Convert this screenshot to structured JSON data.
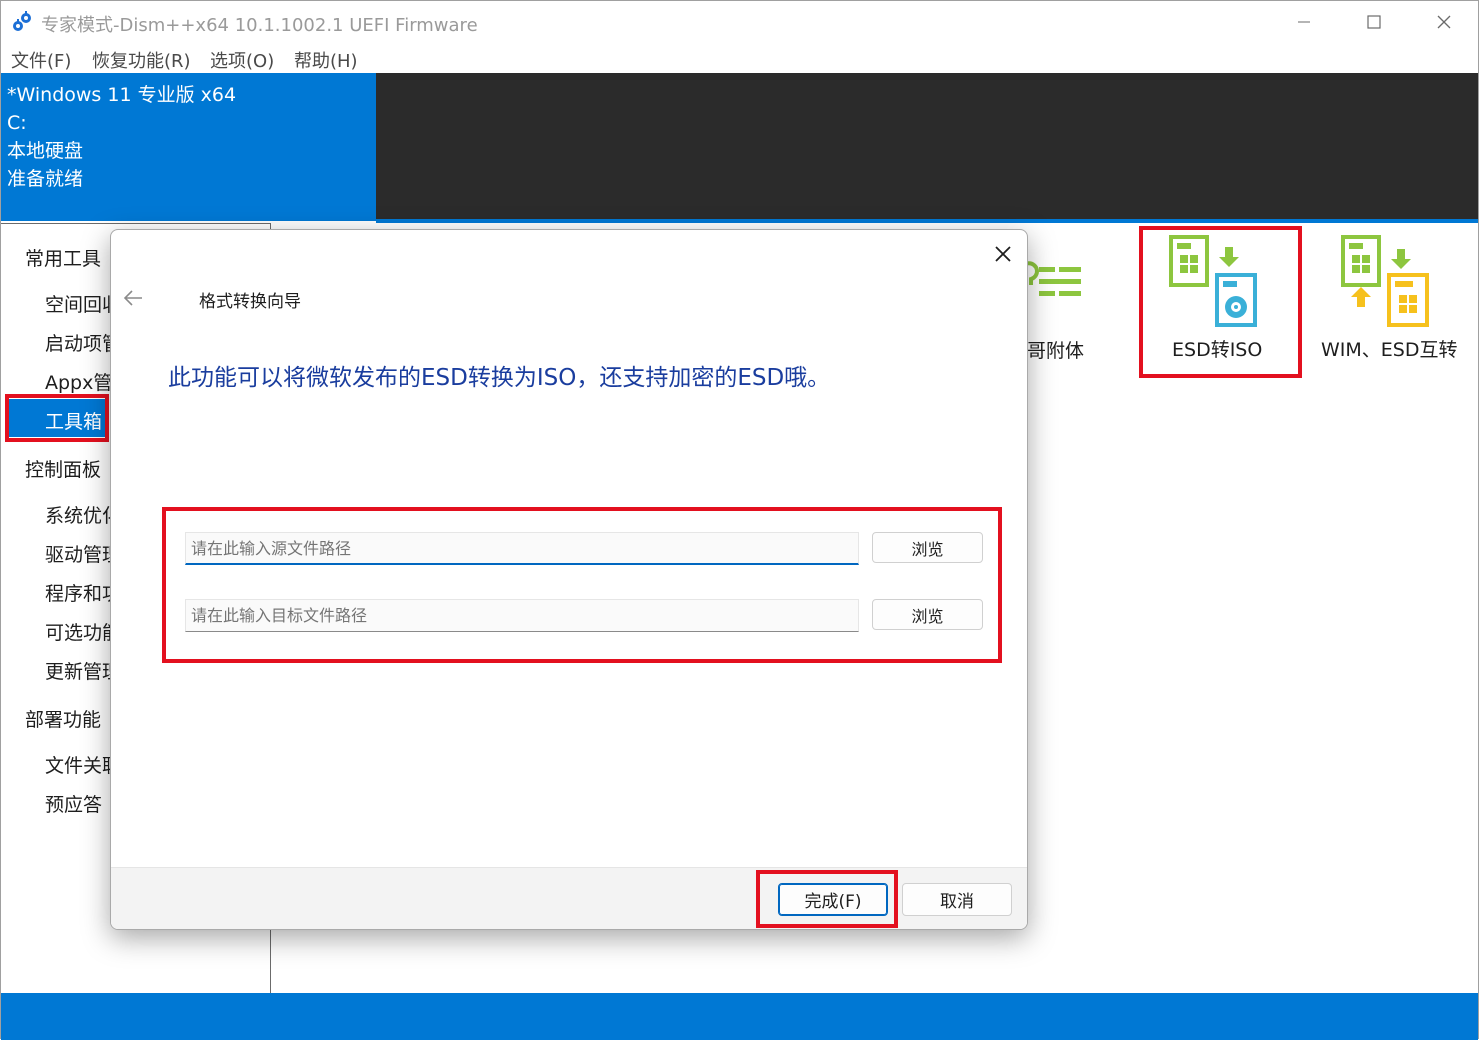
{
  "window": {
    "title": "专家模式-Dism++x64 10.1.1002.1 UEFI Firmware"
  },
  "menu": [
    "文件(F)",
    "恢复功能(R)",
    "选项(O)",
    "帮助(H)"
  ],
  "image_info": {
    "name": "*Windows 11 专业版 x64",
    "drive": "C:",
    "disk": "本地硬盘",
    "status": "准备就绪"
  },
  "sidebar": {
    "groups": [
      {
        "label": "常用工具",
        "items": [
          "空间回收",
          "启动项管",
          "Appx管",
          "工具箱"
        ]
      },
      {
        "label": "控制面板",
        "items": [
          "系统优化",
          "驱动管理",
          "程序和功",
          "可选功能",
          "更新管理"
        ]
      },
      {
        "label": "部署功能",
        "items": [
          "文件关联",
          "预应答"
        ]
      }
    ],
    "selected": "工具箱"
  },
  "tools": {
    "partial_label": "哥附体",
    "esd_to_iso": "ESD转ISO",
    "wim_esd": "WIM、ESD互转"
  },
  "dialog": {
    "title": "格式转换向导",
    "heading": "此功能可以将微软发布的ESD转换为ISO，还支持加密的ESD哦。",
    "source_placeholder": "请在此输入源文件路径",
    "target_placeholder": "请在此输入目标文件路径",
    "browse_label": "浏览",
    "finish_label": "完成(F)",
    "cancel_label": "取消"
  },
  "icons": {
    "app": "gear-icon",
    "back": "arrow-left-icon",
    "close": "close-icon"
  },
  "colors": {
    "accent": "#0078d4",
    "highlight": "#e3101f",
    "heading": "#1a3d9e",
    "tool_green": "#8dc63f",
    "tool_blue": "#3ab0d8",
    "tool_yellow": "#f6c11d"
  }
}
